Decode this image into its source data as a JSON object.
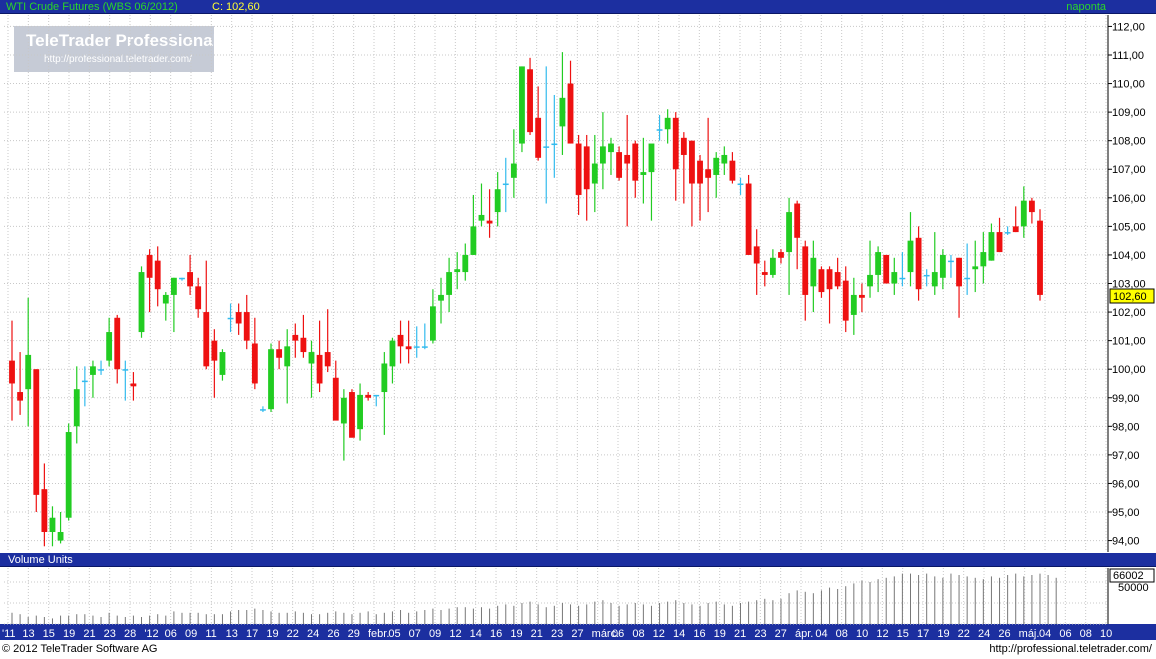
{
  "header": {
    "title": "WTI Crude Futures (WBS 06/2012)",
    "close_label": "C: 102,60",
    "period": "naponta"
  },
  "watermark": {
    "title": "TeleTrader Professional",
    "url": "http://professional.teletrader.com/"
  },
  "volume_panel": {
    "title": "Volume Units",
    "last_value_label": "66002",
    "tick_label": "50000"
  },
  "price_panel": {
    "last_price_label": "102,60"
  },
  "footer": {
    "copyright": "© 2012 TeleTrader Software AG",
    "url": "http://professional.teletrader.com/"
  },
  "colors": {
    "up": "#22cc22",
    "down": "#ee1111",
    "doji": "#33bbee",
    "header_bg": "#1c2fa0",
    "header_text": "#2bd628",
    "close_text": "#ffff33",
    "last_price_bg": "#ffff00"
  },
  "chart_data": [
    {
      "type": "candlestick",
      "title": "WTI Crude Futures (WBS 06/2012)",
      "ylim": [
        93.6,
        112.4
      ],
      "y_ticks": [
        "94,00",
        "95,00",
        "96,00",
        "97,00",
        "98,00",
        "99,00",
        "100,00",
        "101,00",
        "102,00",
        "103,00",
        "104,00",
        "105,00",
        "106,00",
        "107,00",
        "108,00",
        "109,00",
        "110,00",
        "111,00",
        "112,00"
      ],
      "x_labels": [
        "'11",
        "13",
        "15",
        "19",
        "21",
        "23",
        "28",
        "'12",
        "06",
        "09",
        "11",
        "13",
        "17",
        "19",
        "22",
        "24",
        "26",
        "29",
        "febr.",
        "05",
        "07",
        "09",
        "12",
        "14",
        "16",
        "19",
        "21",
        "23",
        "27",
        "márc.",
        "06",
        "08",
        "12",
        "14",
        "16",
        "19",
        "21",
        "23",
        "27",
        "ápr.",
        "04",
        "08",
        "10",
        "12",
        "15",
        "17",
        "19",
        "22",
        "24",
        "26",
        "máj.",
        "04",
        "06",
        "08",
        "10"
      ],
      "series": [
        {
          "ohlc": [
            [
              100.3,
              101.7,
              98.2,
              99.5
            ],
            [
              99.2,
              100.6,
              98.4,
              98.9
            ],
            [
              99.3,
              102.5,
              98.0,
              100.5
            ],
            [
              100.0,
              100.0,
              95.0,
              95.6
            ],
            [
              95.8,
              96.7,
              93.8,
              94.3
            ],
            [
              94.3,
              95.2,
              93.8,
              94.8
            ],
            [
              94.0,
              95.0,
              93.9,
              94.3
            ],
            [
              94.8,
              98.1,
              94.7,
              97.8
            ],
            [
              98.0,
              100.1,
              97.4,
              99.3
            ],
            [
              99.6,
              100.1,
              98.7,
              99.6
            ],
            [
              99.8,
              100.3,
              99.0,
              100.1
            ],
            [
              100.0,
              100.3,
              99.8,
              100.0
            ],
            [
              100.3,
              101.8,
              100.1,
              101.3
            ],
            [
              101.8,
              101.9,
              99.5,
              100.0
            ],
            [
              100.0,
              100.3,
              98.9,
              100.0
            ],
            [
              99.5,
              99.9,
              98.9,
              99.4
            ],
            [
              101.3,
              103.6,
              101.1,
              103.4
            ],
            [
              104.0,
              104.2,
              102.0,
              103.2
            ],
            [
              103.8,
              104.3,
              102.2,
              102.8
            ],
            [
              102.3,
              102.7,
              101.7,
              102.6
            ],
            [
              102.6,
              103.2,
              101.3,
              103.2
            ],
            [
              103.2,
              103.2,
              103.1,
              103.2
            ],
            [
              103.4,
              104.0,
              102.6,
              102.9
            ],
            [
              102.9,
              103.2,
              101.8,
              102.1
            ],
            [
              102.0,
              103.8,
              100.0,
              100.1
            ],
            [
              101.0,
              101.4,
              99.0,
              100.3
            ],
            [
              99.8,
              100.7,
              99.6,
              100.6
            ],
            [
              101.8,
              102.3,
              101.3,
              101.8
            ],
            [
              102.0,
              102.3,
              101.2,
              101.6
            ],
            [
              102.0,
              102.6,
              100.7,
              101.0
            ],
            [
              100.9,
              101.8,
              99.3,
              99.5
            ],
            [
              98.6,
              98.7,
              98.5,
              98.6
            ],
            [
              98.6,
              100.9,
              98.5,
              100.7
            ],
            [
              100.7,
              101.0,
              100.0,
              100.4
            ],
            [
              100.1,
              101.4,
              98.8,
              100.8
            ],
            [
              101.2,
              101.6,
              100.4,
              101.0
            ],
            [
              101.1,
              101.9,
              100.4,
              100.6
            ],
            [
              100.2,
              101.0,
              99.0,
              100.6
            ],
            [
              100.5,
              101.7,
              99.2,
              99.5
            ],
            [
              100.6,
              102.1,
              99.9,
              100.1
            ],
            [
              99.7,
              100.3,
              98.6,
              98.2
            ],
            [
              98.1,
              99.3,
              96.8,
              99.0
            ],
            [
              99.2,
              99.3,
              97.9,
              97.6
            ],
            [
              97.9,
              99.5,
              97.5,
              99.1
            ],
            [
              99.1,
              99.2,
              98.9,
              99.0
            ],
            [
              99.1,
              99.1,
              98.7,
              99.1
            ],
            [
              99.2,
              100.6,
              97.7,
              100.2
            ],
            [
              100.1,
              101.1,
              99.5,
              101.0
            ],
            [
              101.2,
              101.7,
              100.2,
              100.8
            ],
            [
              100.8,
              101.7,
              100.2,
              100.7
            ],
            [
              100.8,
              101.5,
              100.4,
              100.8
            ],
            [
              100.8,
              101.6,
              100.7,
              100.8
            ],
            [
              101.0,
              102.8,
              100.9,
              102.2
            ],
            [
              102.4,
              103.2,
              101.6,
              102.6
            ],
            [
              102.6,
              103.9,
              102.0,
              103.4
            ],
            [
              103.4,
              104.1,
              102.8,
              103.5
            ],
            [
              103.4,
              104.4,
              103.1,
              104.0
            ],
            [
              104.0,
              106.1,
              104.0,
              105.0
            ],
            [
              105.2,
              106.5,
              105.0,
              105.4
            ],
            [
              105.2,
              106.3,
              104.6,
              105.1
            ],
            [
              105.5,
              106.9,
              105.0,
              106.3
            ],
            [
              106.5,
              107.4,
              105.5,
              106.5
            ],
            [
              106.7,
              108.4,
              106.0,
              107.2
            ],
            [
              107.9,
              110.6,
              107.6,
              110.6
            ],
            [
              110.5,
              110.9,
              108.2,
              108.3
            ],
            [
              108.8,
              109.9,
              107.3,
              107.4
            ],
            [
              107.8,
              110.6,
              105.8,
              107.8
            ],
            [
              107.9,
              109.6,
              106.7,
              107.9
            ],
            [
              108.5,
              111.1,
              107.5,
              109.5
            ],
            [
              110.0,
              110.8,
              107.9,
              107.9
            ],
            [
              107.9,
              108.2,
              105.4,
              106.1
            ],
            [
              107.8,
              108.2,
              105.2,
              106.3
            ],
            [
              106.5,
              108.2,
              105.5,
              107.2
            ],
            [
              107.2,
              109.0,
              106.3,
              107.8
            ],
            [
              107.6,
              108.1,
              106.8,
              107.9
            ],
            [
              107.6,
              107.8,
              106.6,
              106.7
            ],
            [
              107.5,
              108.9,
              105.0,
              107.2
            ],
            [
              107.9,
              108.0,
              106.0,
              106.6
            ],
            [
              106.8,
              108.1,
              105.8,
              106.9
            ],
            [
              106.9,
              107.8,
              105.2,
              107.9
            ],
            [
              108.4,
              108.9,
              108.0,
              108.4
            ],
            [
              108.4,
              109.1,
              107.9,
              108.8
            ],
            [
              108.8,
              109.0,
              105.9,
              107.0
            ],
            [
              108.1,
              108.3,
              105.8,
              107.5
            ],
            [
              108.0,
              108.0,
              105.0,
              106.5
            ],
            [
              107.3,
              107.5,
              105.2,
              106.5
            ],
            [
              107.0,
              108.8,
              105.5,
              106.7
            ],
            [
              106.8,
              107.6,
              106.0,
              107.4
            ],
            [
              107.2,
              107.8,
              106.8,
              107.5
            ],
            [
              107.3,
              107.6,
              106.5,
              106.6
            ],
            [
              106.5,
              106.7,
              106.1,
              106.5
            ],
            [
              106.5,
              106.8,
              104.0,
              104.0
            ],
            [
              104.3,
              104.9,
              102.6,
              103.7
            ],
            [
              103.4,
              103.8,
              102.9,
              103.3
            ],
            [
              103.3,
              104.2,
              103.2,
              103.9
            ],
            [
              104.1,
              104.2,
              103.7,
              103.9
            ],
            [
              104.1,
              106.0,
              102.6,
              105.5
            ],
            [
              105.8,
              105.9,
              103.5,
              104.6
            ],
            [
              104.3,
              104.5,
              101.7,
              102.6
            ],
            [
              102.9,
              104.5,
              102.0,
              103.9
            ],
            [
              103.5,
              103.6,
              102.5,
              102.7
            ],
            [
              103.5,
              103.6,
              101.6,
              102.8
            ],
            [
              103.4,
              103.9,
              102.8,
              102.9
            ],
            [
              103.1,
              103.6,
              101.3,
              101.7
            ],
            [
              101.9,
              103.2,
              101.2,
              102.6
            ],
            [
              102.6,
              103.0,
              102.0,
              102.5
            ],
            [
              102.9,
              104.5,
              102.5,
              103.3
            ],
            [
              103.3,
              104.3,
              102.7,
              104.1
            ],
            [
              104.0,
              104.0,
              103.1,
              103.0
            ],
            [
              103.0,
              103.9,
              102.6,
              103.4
            ],
            [
              103.2,
              104.1,
              102.9,
              103.2
            ],
            [
              103.4,
              105.5,
              102.9,
              104.5
            ],
            [
              104.6,
              105.0,
              102.4,
              102.8
            ],
            [
              103.3,
              103.5,
              102.9,
              103.3
            ],
            [
              102.9,
              104.8,
              102.6,
              103.4
            ],
            [
              103.2,
              104.2,
              102.8,
              104.0
            ],
            [
              103.8,
              104.0,
              103.2,
              103.8
            ],
            [
              103.9,
              103.9,
              101.8,
              102.9
            ],
            [
              103.2,
              104.4,
              102.6,
              103.2
            ],
            [
              103.5,
              104.5,
              102.7,
              103.6
            ],
            [
              103.6,
              104.8,
              103.0,
              104.1
            ],
            [
              103.8,
              105.1,
              103.8,
              104.8
            ],
            [
              104.8,
              105.3,
              104.1,
              104.1
            ],
            [
              104.8,
              105.0,
              104.7,
              104.8
            ],
            [
              105.0,
              105.7,
              104.8,
              104.8
            ],
            [
              105.0,
              106.4,
              104.6,
              105.9
            ],
            [
              105.9,
              106.0,
              105.1,
              105.5
            ],
            [
              105.2,
              105.6,
              102.4,
              102.6
            ]
          ]
        },
        {
          "name": "Volume Units",
          "values": [
            8,
            7,
            5,
            6,
            5,
            4,
            6,
            6,
            7,
            7,
            6,
            5,
            8,
            6,
            5,
            6,
            5,
            6,
            7,
            6,
            9,
            8,
            8,
            8,
            7,
            7,
            7,
            9,
            10,
            10,
            11,
            10,
            9,
            8,
            8,
            9,
            8,
            7,
            7,
            8,
            9,
            8,
            7,
            8,
            9,
            7,
            8,
            9,
            10,
            8,
            9,
            10,
            11,
            10,
            11,
            12,
            12,
            11,
            12,
            11,
            13,
            14,
            13,
            15,
            16,
            14,
            12,
            13,
            15,
            14,
            13,
            14,
            16,
            17,
            15,
            13,
            14,
            15,
            14,
            13,
            15,
            16,
            17,
            15,
            14,
            13,
            15,
            16,
            14,
            13,
            15,
            16,
            17,
            18,
            17,
            18,
            22,
            24,
            23,
            22,
            24,
            26,
            25,
            27,
            29,
            31,
            30,
            32,
            33,
            34,
            36,
            36,
            35,
            36,
            34,
            33,
            36,
            35,
            34,
            33,
            32,
            34,
            33,
            35,
            36,
            34,
            35,
            36,
            35,
            33
          ]
        }
      ]
    }
  ]
}
